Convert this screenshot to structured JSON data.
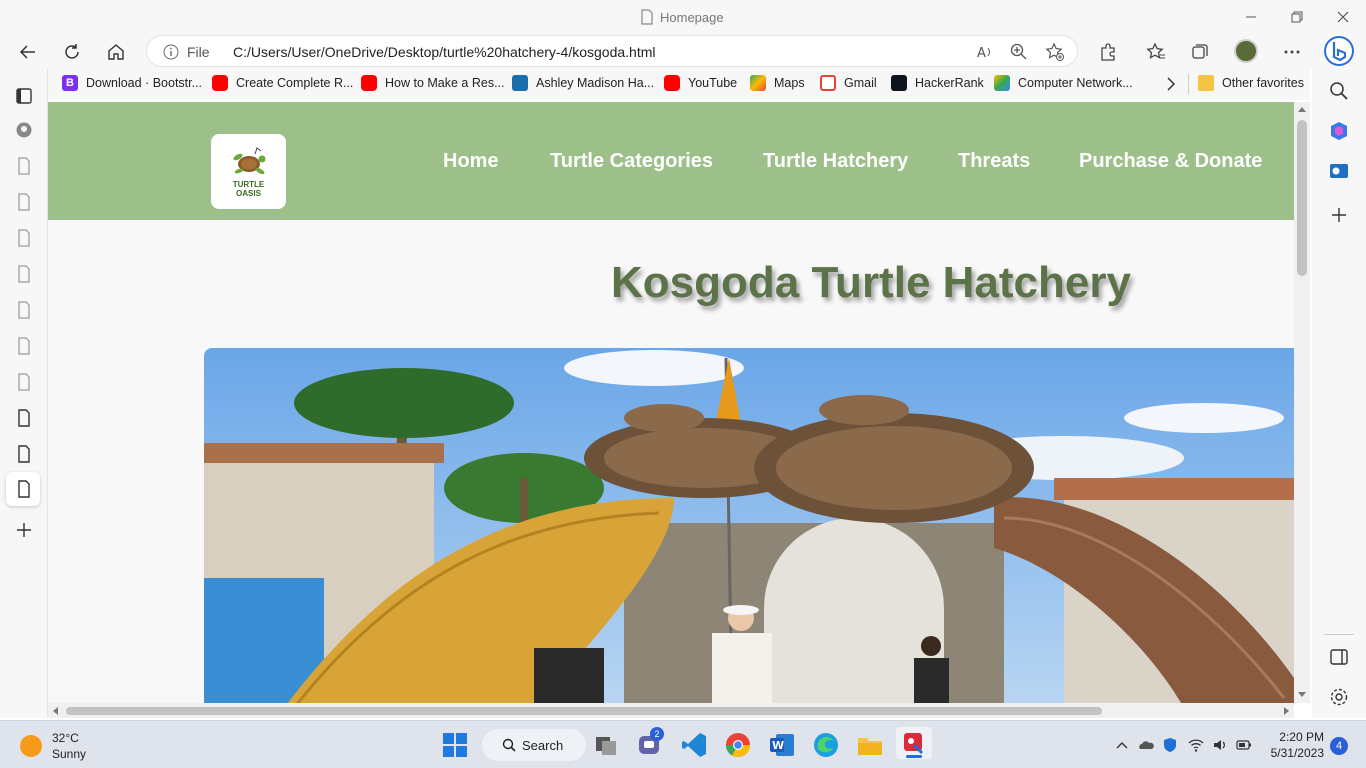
{
  "window": {
    "title": "Homepage"
  },
  "address_bar": {
    "scheme_label": "File",
    "url": "C:/Users/User/OneDrive/Desktop/turtle%20hatchery-4/kosgoda.html"
  },
  "favorites": [
    {
      "label": "Download · Bootstr...",
      "icon": "bootstrap-icon",
      "color": "#7b2ff7"
    },
    {
      "label": "Create Complete R...",
      "icon": "youtube-icon",
      "color": "#ff0000"
    },
    {
      "label": "How to Make a Res...",
      "icon": "youtube-icon",
      "color": "#ff0000"
    },
    {
      "label": "Ashley Madison Ha...",
      "icon": "site-icon",
      "color": "#1b6ea8"
    },
    {
      "label": "YouTube",
      "icon": "youtube-icon",
      "color": "#ff0000"
    },
    {
      "label": "Maps",
      "icon": "maps-icon",
      "color": "#34a853"
    },
    {
      "label": "Gmail",
      "icon": "gmail-icon",
      "color": "#ea4335"
    },
    {
      "label": "HackerRank",
      "icon": "hackerrank-icon",
      "color": "#0e141e"
    },
    {
      "label": "Computer Network...",
      "icon": "drive-icon",
      "color": "#fbbc04"
    }
  ],
  "favorites_other": "Other favorites",
  "site": {
    "logo_text_1": "TURTLE",
    "logo_text_2": "OASIS",
    "nav": [
      "Home",
      "Turtle Categories",
      "Turtle Hatchery",
      "Threats",
      "Purchase & Donate"
    ],
    "heading": "Kosgoda Turtle Hatchery",
    "header_color": "#9dc08b",
    "heading_color": "#5c7248"
  },
  "taskbar": {
    "weather_temp": "32°C",
    "weather_desc": "Sunny",
    "search_label": "Search",
    "teams_badge": "2",
    "time": "2:20 PM",
    "date": "5/31/2023",
    "notifications": "4"
  }
}
